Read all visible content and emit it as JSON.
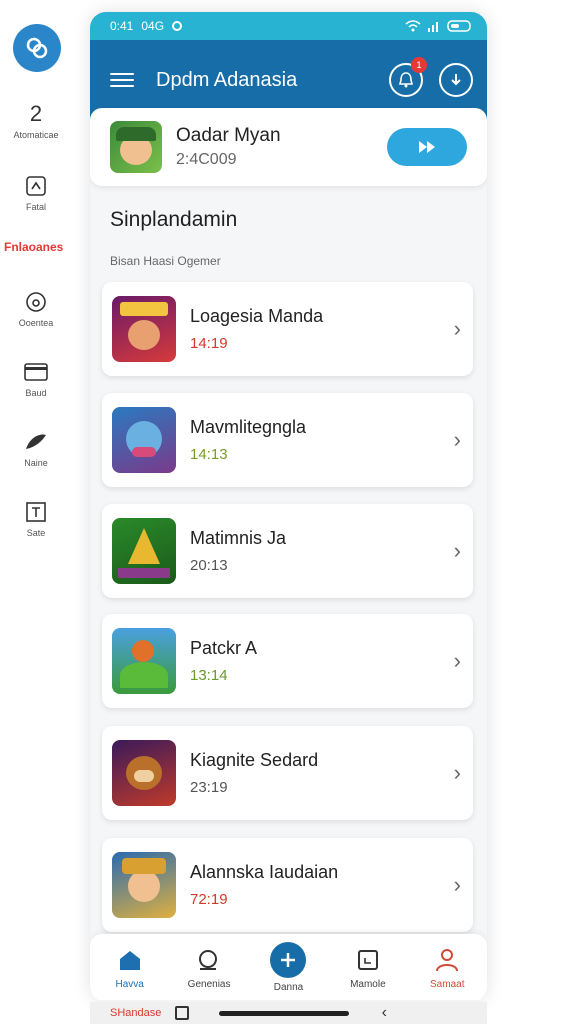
{
  "rail": {
    "items": [
      {
        "label": "Atomaticae",
        "icon": "two-icon"
      },
      {
        "label": "Fatal",
        "icon": "wallet-icon"
      },
      {
        "label": "Ooentea",
        "icon": "drop-icon"
      },
      {
        "label": "Baud",
        "icon": "card-icon"
      },
      {
        "label": "Naine",
        "icon": "leaf-icon"
      },
      {
        "label": "Sate",
        "icon": "frame-icon"
      }
    ],
    "active_label": "Fnlaoanes"
  },
  "status": {
    "time": "0:41",
    "left_text": "04G",
    "signal": "wifi-signal-battery"
  },
  "app_bar": {
    "title": "Dpdm Adanasia"
  },
  "notif_count": "1",
  "featured": {
    "name": "Oadar Myan",
    "time": "2:4C009",
    "button_icon": "play-icon"
  },
  "section": {
    "title": "Sinplandamin",
    "subtitle": "Bisan Haasi Ogemer"
  },
  "games": [
    {
      "name": "Loagesia Manda",
      "time": "14:19",
      "time_color": "#d33a2a"
    },
    {
      "name": "Mavmlitegngla",
      "time": "14:13",
      "time_color": "#7a9a2a"
    },
    {
      "name": "Matimnis Ja",
      "time": "20:13",
      "time_color": "#555555"
    },
    {
      "name": "Patckr A",
      "time": "13:14",
      "time_color": "#6a9a2a"
    },
    {
      "name": "Kiagnite Sedard",
      "time": "23:19",
      "time_color": "#555555"
    },
    {
      "name": "Alannska Iaudaian",
      "time": "72:19",
      "time_color": "#d33a2a"
    }
  ],
  "bottom_nav": [
    {
      "label": "Havva",
      "color": "#1e6fb0"
    },
    {
      "label": "Genenias",
      "color": "#444444"
    },
    {
      "label": "Danna",
      "color": "#444444"
    },
    {
      "label": "Mamole",
      "color": "#444444"
    },
    {
      "label": "Samaat",
      "color": "#d04a3a"
    }
  ],
  "sys_bar": {
    "label": "SHandase"
  }
}
